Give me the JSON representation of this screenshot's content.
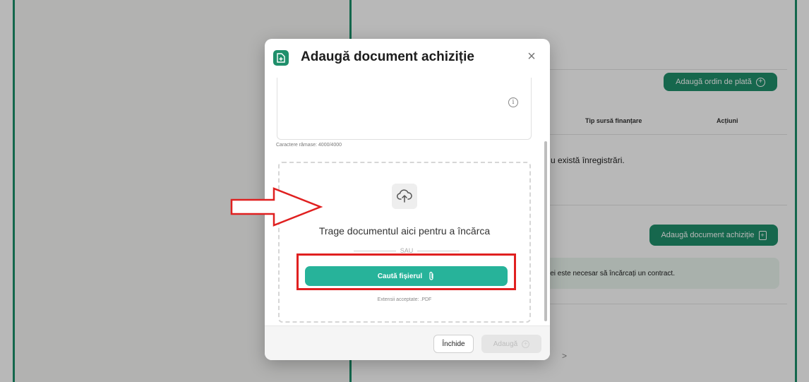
{
  "background": {
    "add_payment_order_label": "Adaugă ordin de plată",
    "table_headers": [
      "Tip sursă finanțare",
      "Acțiuni"
    ],
    "empty_state": "u există înregistrări.",
    "add_procurement_doc_label": "Adaugă document achiziție",
    "info_text": "iției este necesar să încărcați un contract.",
    "chevron_text": ">"
  },
  "modal": {
    "title": "Adaugă document achiziție",
    "close_symbol": "×",
    "info_symbol": "i",
    "chars_remaining": "Caractere rămase: 4000/4000",
    "dropzone": {
      "drop_text": "Trage documentul aici pentru a încărca",
      "or_text": "SAU",
      "browse_label": "Caută fișierul",
      "accepted_ext": "Extensii acceptate: .PDF"
    },
    "footer": {
      "close_label": "Închide",
      "add_label": "Adaugă"
    }
  },
  "colors": {
    "brand_green": "#1f8f6b",
    "browse_teal": "#27b39a",
    "annotation_red": "#e02020"
  },
  "icons": {
    "modal_icon": "document-add-icon",
    "upload": "cloud-upload-icon",
    "attach": "paperclip-icon"
  }
}
